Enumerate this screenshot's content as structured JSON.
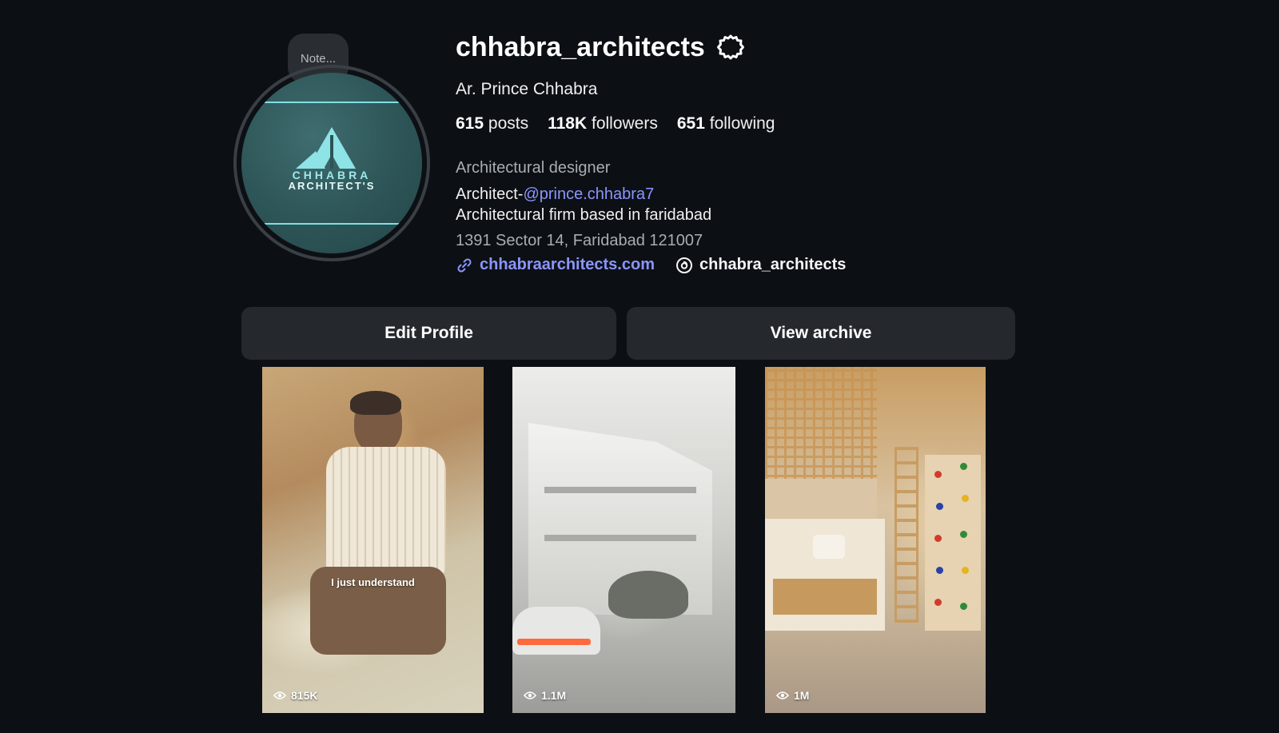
{
  "profile": {
    "note_label": "Note...",
    "avatar_icon": "chhabra-architects-logo",
    "avatar_text_line1": "CHHABRA",
    "avatar_text_line2": "ARCHITECT'S",
    "username": "chhabra_architects",
    "settings_icon": "gear-icon",
    "full_name": "Ar. Prince Chhabra",
    "stats": {
      "posts_count": "615",
      "posts_label": "posts",
      "followers_count": "118K",
      "followers_label": "followers",
      "following_count": "651",
      "following_label": "following"
    },
    "category": "Architectural designer",
    "bio_line1_prefix": "Architect-",
    "bio_line1_mention": "@prince.chhabra7",
    "bio_line2": "Architectural firm based in faridabad",
    "address": "1391 Sector 14, Faridabad 121007",
    "website": "chhabraarchitects.com",
    "threads_handle": "chhabra_architects"
  },
  "actions": {
    "edit_profile": "Edit Profile",
    "view_archive": "View archive"
  },
  "posts": [
    {
      "caption": "I just understand",
      "views": "815K"
    },
    {
      "caption": "",
      "views": "1.1M"
    },
    {
      "caption": "",
      "views": "1M"
    }
  ],
  "colors": {
    "background": "#0c1014",
    "button": "#25292e",
    "link": "#8b95ff",
    "muted_text": "#a8adb3"
  }
}
